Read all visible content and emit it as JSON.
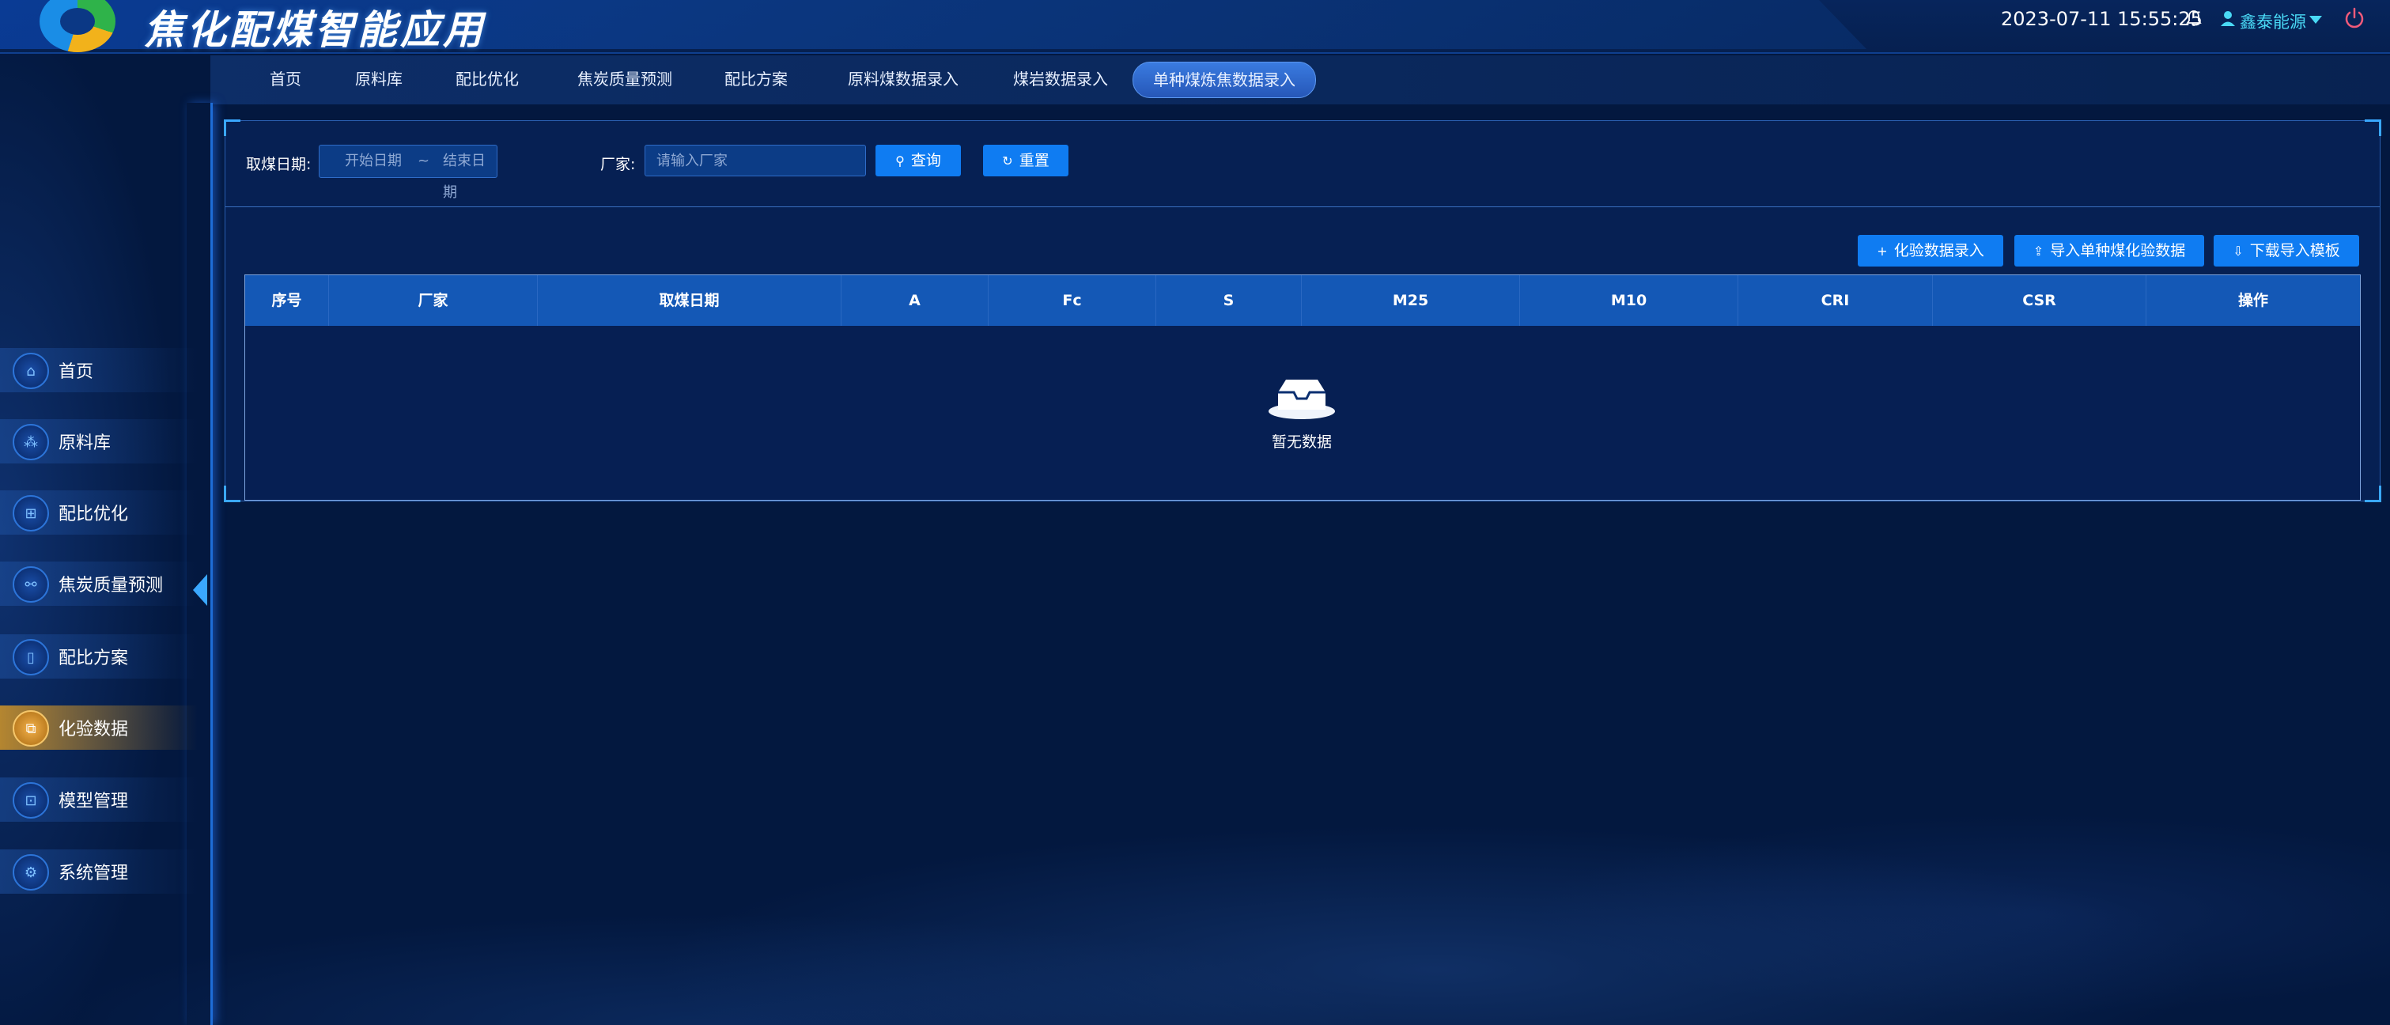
{
  "header": {
    "app_title": "焦化配煤智能应用",
    "datetime": "2023-07-11 15:55:25",
    "username": "鑫泰能源"
  },
  "top_nav": {
    "items": [
      {
        "label": "首页"
      },
      {
        "label": "原料库"
      },
      {
        "label": "配比优化"
      },
      {
        "label": "焦炭质量预测"
      },
      {
        "label": "配比方案"
      },
      {
        "label": "原料煤数据录入"
      },
      {
        "label": "煤岩数据录入"
      },
      {
        "label": "单种煤炼焦数据录入",
        "active": true
      }
    ]
  },
  "sidebar": {
    "items": [
      {
        "label": "首页",
        "icon": "home-icon"
      },
      {
        "label": "原料库",
        "icon": "materials-icon"
      },
      {
        "label": "配比优化",
        "icon": "optimize-icon"
      },
      {
        "label": "焦炭质量预测",
        "icon": "predict-icon"
      },
      {
        "label": "配比方案",
        "icon": "plan-icon"
      },
      {
        "label": "化验数据",
        "icon": "lab-data-icon",
        "active": true
      },
      {
        "label": "模型管理",
        "icon": "model-icon"
      },
      {
        "label": "系统管理",
        "icon": "settings-icon"
      }
    ]
  },
  "filters": {
    "date_label": "取煤日期:",
    "start_placeholder": "开始日期",
    "range_sep": "~",
    "end_placeholder": "结束日期",
    "factory_label": "厂家:",
    "factory_placeholder": "请输入厂家",
    "query_label": "查询",
    "reset_label": "重置"
  },
  "actions": {
    "add_label": "化验数据录入",
    "import_label": "导入单种煤化验数据",
    "download_label": "下载导入模板"
  },
  "table": {
    "columns": [
      "序号",
      "厂家",
      "取煤日期",
      "A",
      "Fc",
      "S",
      "M25",
      "M10",
      "CRI",
      "CSR",
      "操作"
    ],
    "rows": [],
    "empty_text": "暂无数据"
  },
  "colors": {
    "accent": "#0f7cf2",
    "active_side": "#d2962a",
    "username": "#49d9f5",
    "background": "#03183f"
  }
}
